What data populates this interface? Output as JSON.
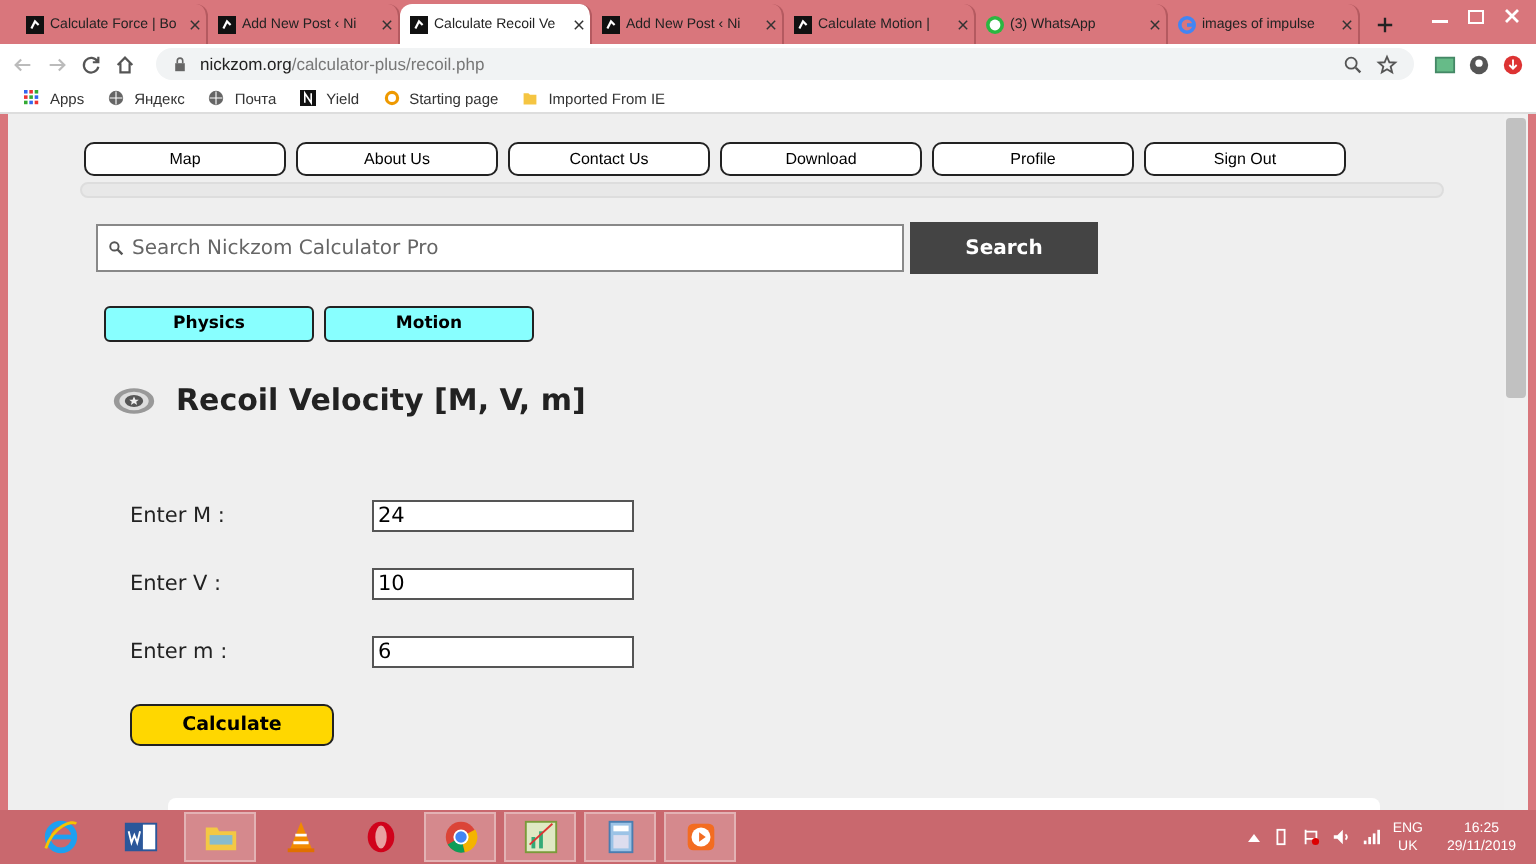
{
  "browser": {
    "tabs": [
      {
        "title": "Calculate Force | Bo",
        "selected": false,
        "kind": "site"
      },
      {
        "title": "Add New Post ‹ Ni",
        "selected": false,
        "kind": "site"
      },
      {
        "title": "Calculate Recoil Ve",
        "selected": true,
        "kind": "site"
      },
      {
        "title": "Add New Post ‹ Ni",
        "selected": false,
        "kind": "site"
      },
      {
        "title": "Calculate Motion |",
        "selected": false,
        "kind": "site"
      },
      {
        "title": "(3) WhatsApp",
        "selected": false,
        "kind": "chat"
      },
      {
        "title": "images of impulse",
        "selected": false,
        "kind": "search"
      }
    ],
    "address": {
      "host": "nickzom.org",
      "path": "/calculator-plus/recoil.php"
    },
    "bookmarks": [
      {
        "label": "Apps",
        "kind": "grid"
      },
      {
        "label": "Яндекс",
        "kind": "globe"
      },
      {
        "label": "Почта",
        "kind": "globe"
      },
      {
        "label": "Yield",
        "kind": "letter"
      },
      {
        "label": "Starting page",
        "kind": "ring"
      },
      {
        "label": "Imported From IE",
        "kind": "folder"
      }
    ]
  },
  "page": {
    "nav": [
      "Map",
      "About Us",
      "Contact Us",
      "Download",
      "Profile",
      "Sign Out"
    ],
    "search": {
      "placeholder": "Search Nickzom Calculator Pro",
      "button": "Search"
    },
    "categories": [
      "Physics",
      "Motion"
    ],
    "heading": "Recoil Velocity [M, V, m]",
    "fields": [
      {
        "label": "Enter M :",
        "value": "24"
      },
      {
        "label": "Enter V :",
        "value": "10"
      },
      {
        "label": "Enter m :",
        "value": "6"
      }
    ],
    "calculate": "Calculate"
  },
  "taskbar": {
    "apps": [
      {
        "kind": "ie",
        "running": false
      },
      {
        "kind": "word",
        "running": false
      },
      {
        "kind": "folder",
        "running": true
      },
      {
        "kind": "cone",
        "running": false
      },
      {
        "kind": "opera",
        "running": false
      },
      {
        "kind": "chrome",
        "running": true
      },
      {
        "kind": "chart",
        "running": true
      },
      {
        "kind": "calculator",
        "running": true
      },
      {
        "kind": "player",
        "running": true
      }
    ],
    "language": "ENG",
    "region": "UK",
    "time": "16:25",
    "date": "29/11/2019"
  }
}
